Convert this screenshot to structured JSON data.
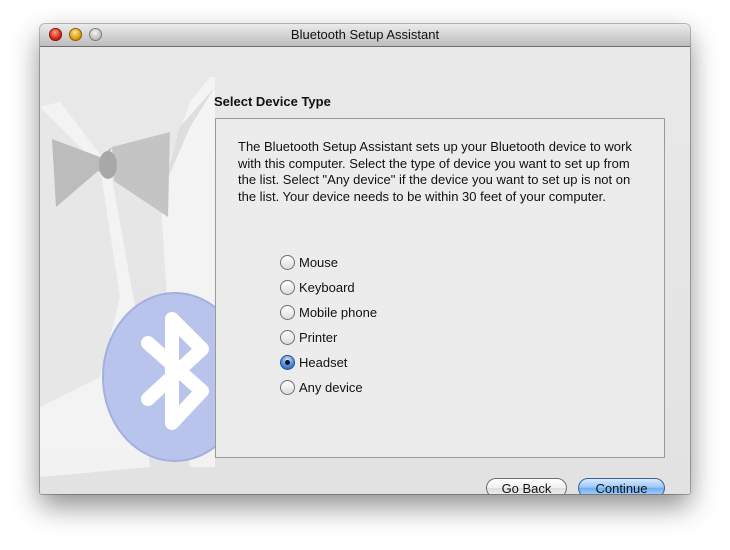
{
  "window": {
    "title": "Bluetooth Setup Assistant"
  },
  "page": {
    "section_title": "Select Device Type",
    "description": "The Bluetooth Setup Assistant sets up your Bluetooth device to work with this computer. Select the type of device you want to set up from the list. Select \"Any device\" if the device you want to set up is not on the list. Your device needs to be within 30 feet of your computer."
  },
  "device_types": {
    "selected": "Headset",
    "options": [
      {
        "label": "Mouse",
        "selected": false
      },
      {
        "label": "Keyboard",
        "selected": false
      },
      {
        "label": "Mobile phone",
        "selected": false
      },
      {
        "label": "Printer",
        "selected": false
      },
      {
        "label": "Headset",
        "selected": true
      },
      {
        "label": "Any device",
        "selected": false
      }
    ]
  },
  "buttons": {
    "back_label": "Go Back",
    "continue_label": "Continue"
  },
  "colors": {
    "default_button": "#6faeef",
    "bluetooth_badge": "#b9c4ec"
  },
  "icons": {
    "background": "tuxedo-bluetooth-icon"
  }
}
